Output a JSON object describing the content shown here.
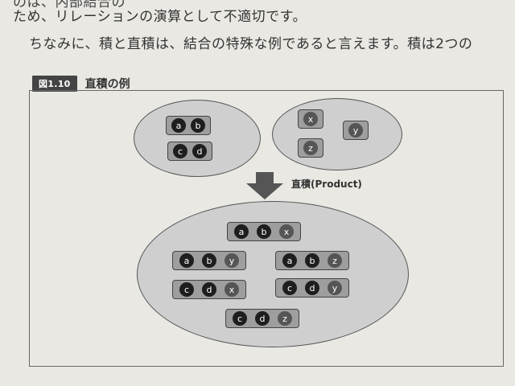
{
  "text_lines": [
    "のは、内部結合の",
    "ため、リレーションの演算として不適切です。",
    "ちなみに、積と直積は、結合の特殊な例であると言えます。積は2つの"
  ],
  "figure": {
    "badge": "図1.10",
    "title": "直積の例",
    "arrow_label": "直積(Product)"
  },
  "set_a": [
    [
      "a",
      "b"
    ],
    [
      "c",
      "d"
    ]
  ],
  "set_b": [
    [
      "x"
    ],
    [
      "y"
    ],
    [
      "z"
    ]
  ],
  "product": [
    [
      "a",
      "b",
      "x"
    ],
    [
      "a",
      "b",
      "y"
    ],
    [
      "a",
      "b",
      "z"
    ],
    [
      "c",
      "d",
      "x"
    ],
    [
      "c",
      "d",
      "y"
    ],
    [
      "c",
      "d",
      "z"
    ]
  ],
  "colors": {
    "dark_element": "#1e1e1e",
    "light_element": "#555555",
    "tuple_fill": "#9e9e9e",
    "ellipse_fill": "#cfcfcf",
    "page": "#e9e8e3"
  }
}
